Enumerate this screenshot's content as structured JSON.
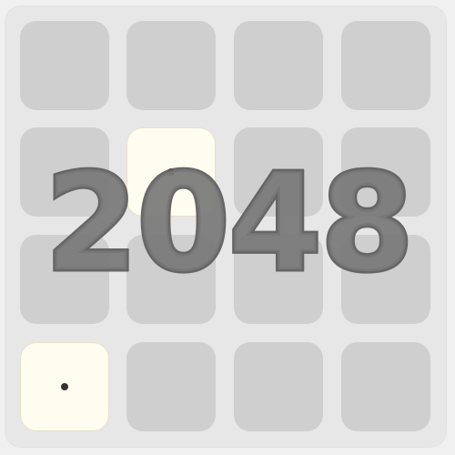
{
  "game": {
    "title": "2048",
    "board_size": 4,
    "tiles": [
      {
        "row": 1,
        "col": 1,
        "value": ""
      },
      {
        "row": 3,
        "col": 0,
        "value": ""
      }
    ]
  },
  "colors": {
    "background": "#f0f0f0",
    "board": "#e7e7e7",
    "empty_cell": "#cfcfcf",
    "tile": "#fffdf0",
    "title": "#787878"
  },
  "icons": {
    "tile_marker": "dot-icon"
  }
}
